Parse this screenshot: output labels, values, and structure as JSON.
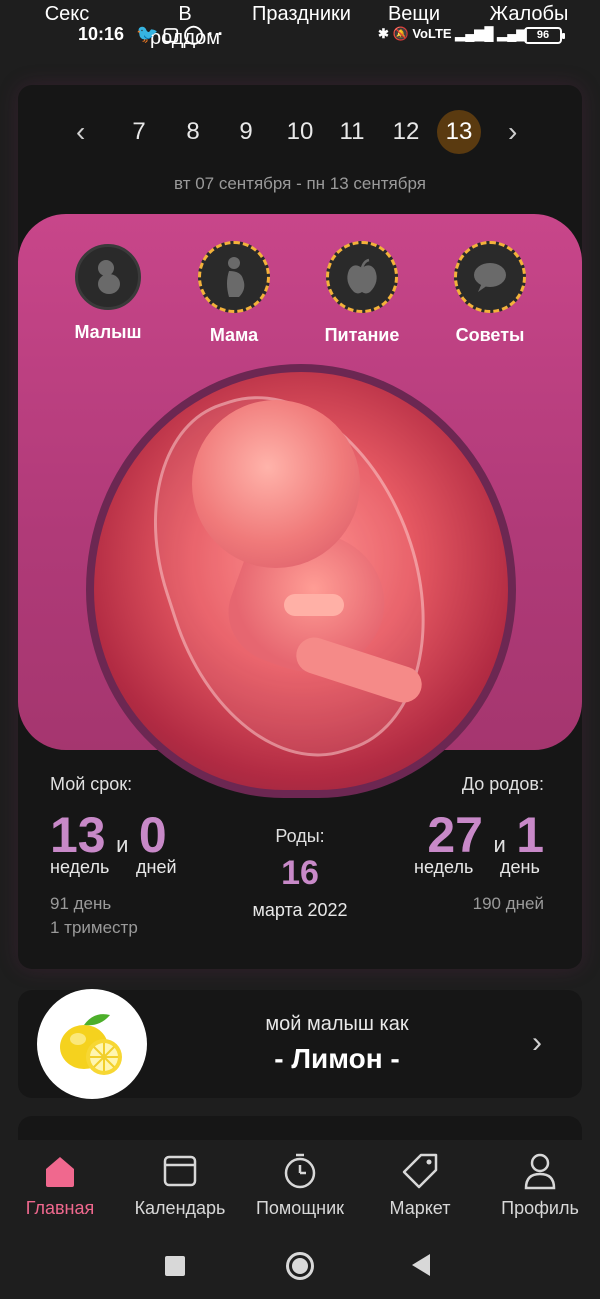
{
  "top_tabs": [
    "Секс",
    "В роддом",
    "Праздники",
    "Вещи",
    "Жалобы"
  ],
  "status": {
    "time": "10:16",
    "battery": "96"
  },
  "week": {
    "days": [
      "7",
      "8",
      "9",
      "10",
      "11",
      "12",
      "13"
    ],
    "active_day": "13",
    "range": "вт 07 сентября - пн 13 сентября"
  },
  "categories": [
    {
      "label": "Малыш",
      "icon": "baby-icon"
    },
    {
      "label": "Мама",
      "icon": "mother-icon"
    },
    {
      "label": "Питание",
      "icon": "apple-icon"
    },
    {
      "label": "Советы",
      "icon": "chat-bubble-icon"
    }
  ],
  "term": {
    "title": "Мой срок:",
    "weeks": "13",
    "and": "и",
    "days": "0",
    "weeks_unit": "недель",
    "days_unit": "дней",
    "total_days": "91 день",
    "trimester": "1 триместр"
  },
  "birth": {
    "title": "Роды:",
    "day": "16",
    "month_year": "марта 2022"
  },
  "remaining": {
    "title": "До родов:",
    "weeks": "27",
    "and": "и",
    "days": "1",
    "weeks_unit": "недель",
    "days_unit": "день",
    "total_days": "190 дней"
  },
  "baby_size": {
    "caption": "мой малыш как",
    "fruit": "- Лимон -"
  },
  "bottom_nav": [
    {
      "label": "Главная",
      "icon": "home-icon",
      "active": true
    },
    {
      "label": "Календарь",
      "icon": "calendar-icon"
    },
    {
      "label": "Помощник",
      "icon": "stopwatch-icon"
    },
    {
      "label": "Маркет",
      "icon": "tag-icon"
    },
    {
      "label": "Профиль",
      "icon": "profile-icon"
    }
  ],
  "colors": {
    "accent": "#c889c8",
    "panel_pink": "#c8468a",
    "active_nav": "#f0688e",
    "active_day_bg": "#5a3a10",
    "dashed_ring": "#f3b23a"
  }
}
